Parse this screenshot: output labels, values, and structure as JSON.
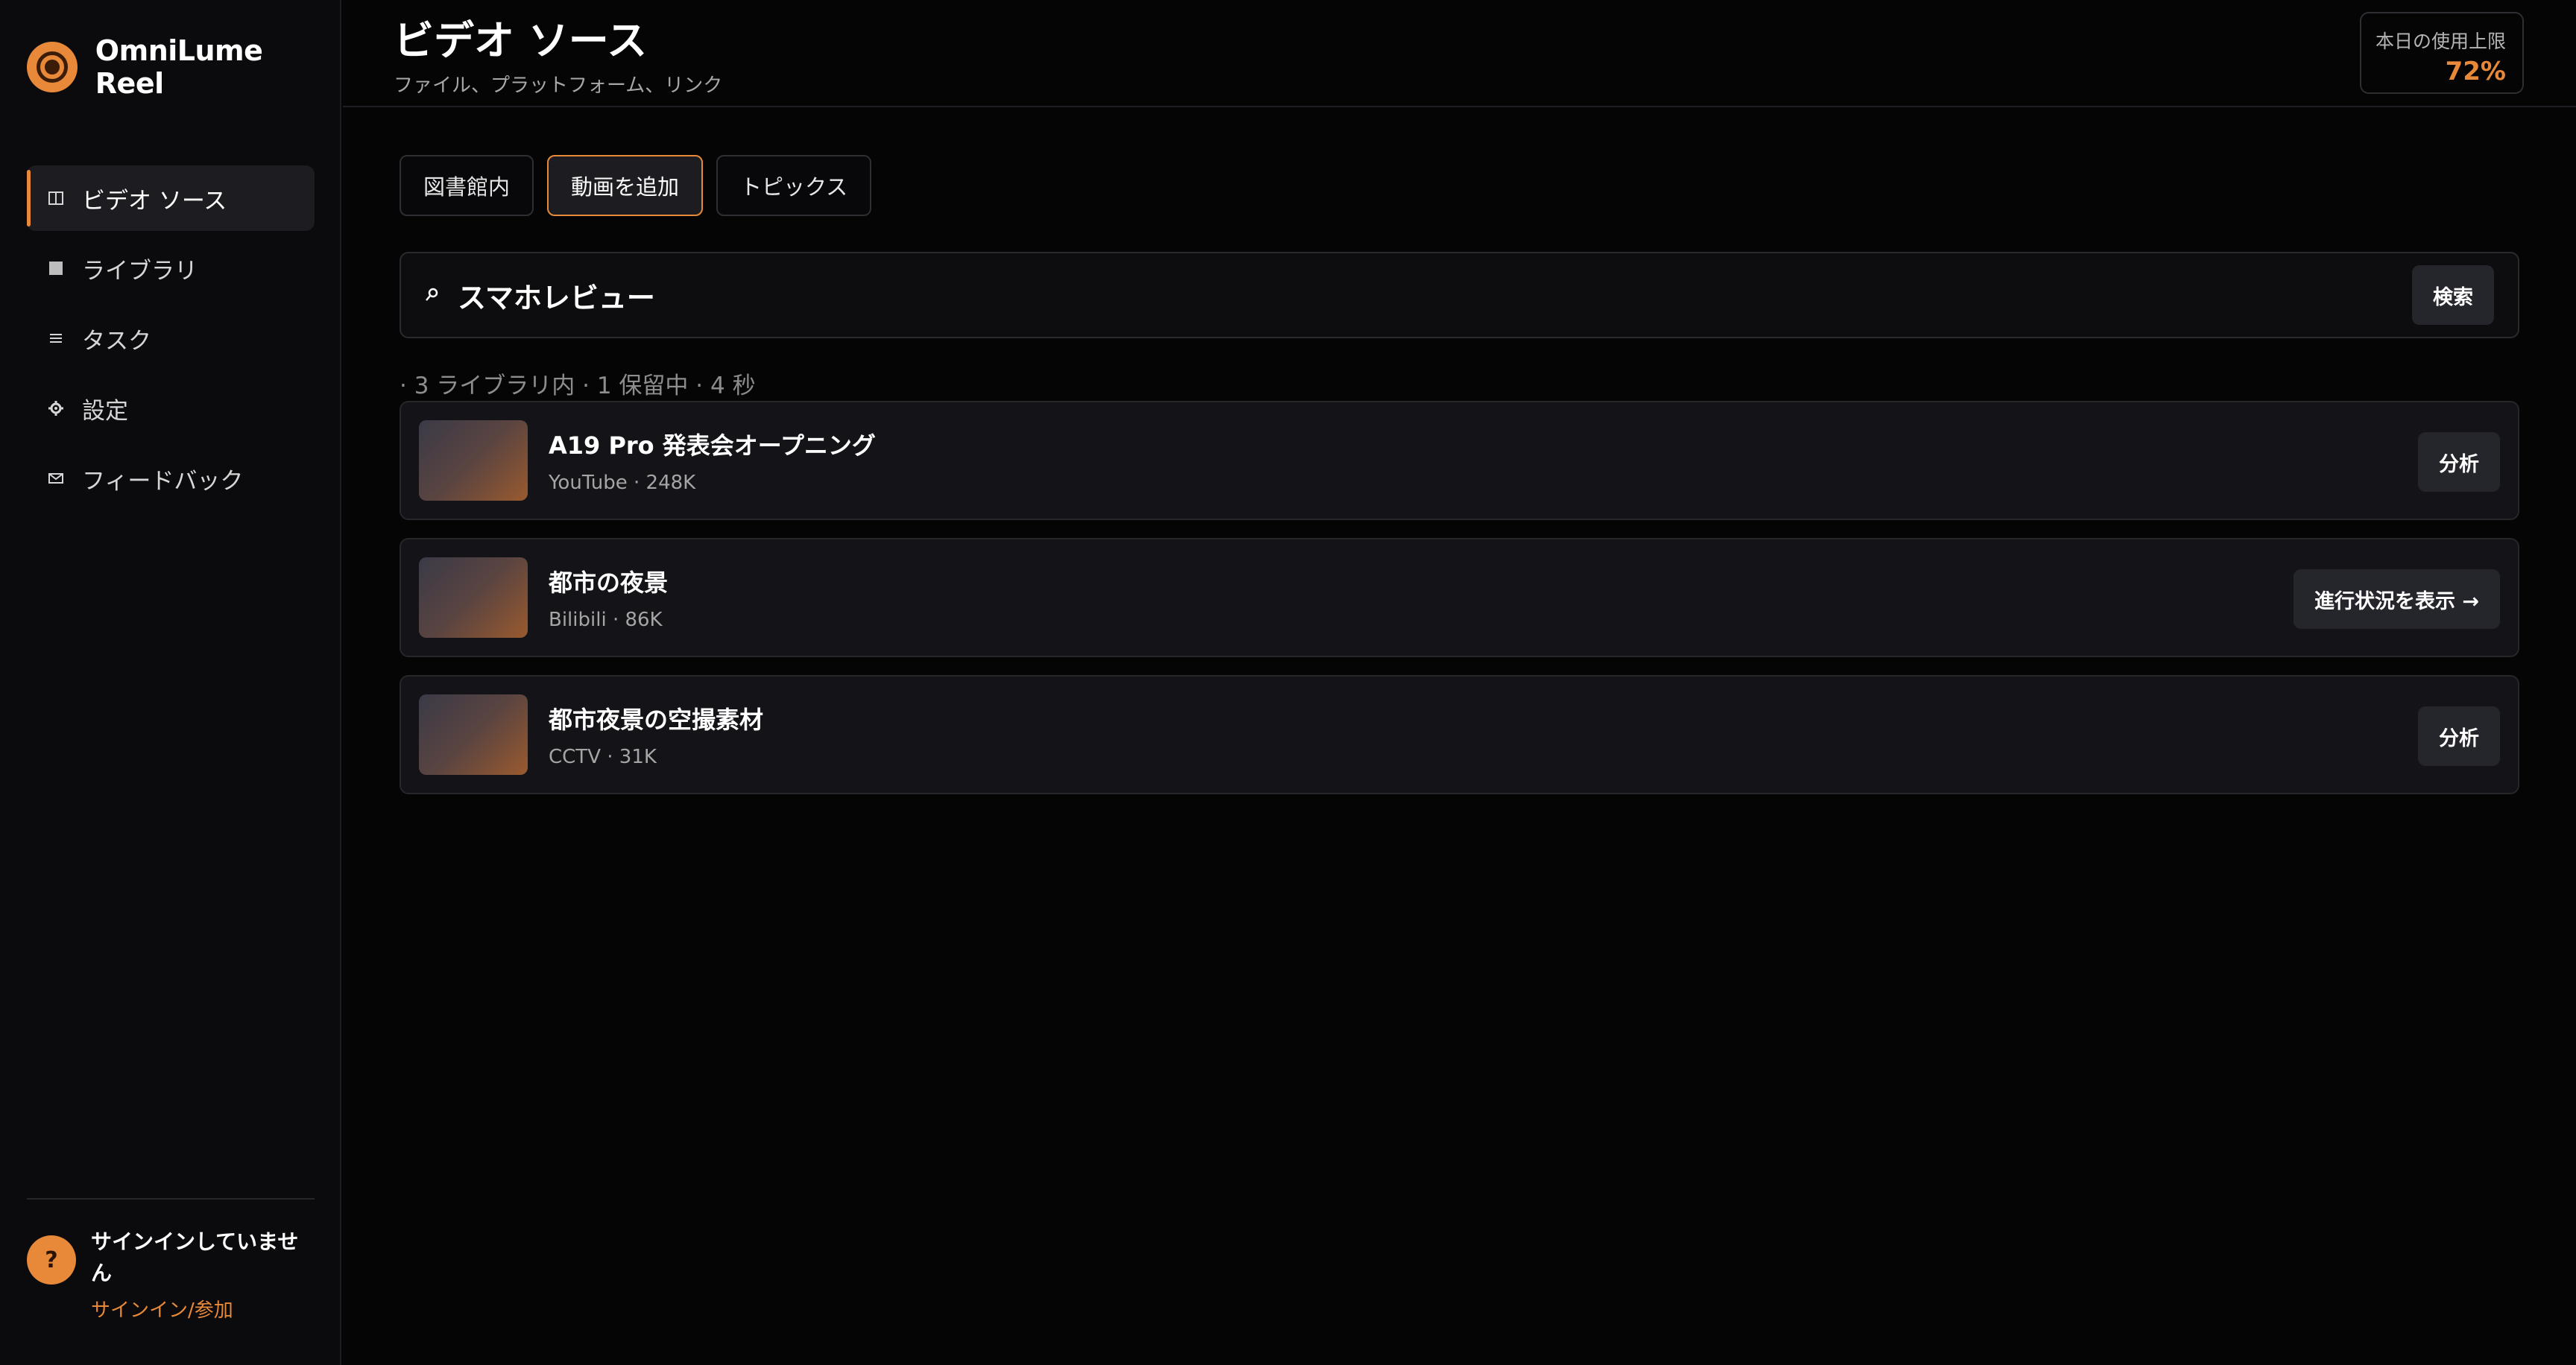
{
  "app": {
    "name": "OmniLume Reel"
  },
  "sidebar": {
    "items": [
      {
        "label": "ビデオ ソース",
        "icon": "columns-icon"
      },
      {
        "label": "ライブラリ",
        "icon": "square-icon"
      },
      {
        "label": "タスク",
        "icon": "list-icon"
      },
      {
        "label": "設定",
        "icon": "gear-icon"
      },
      {
        "label": "フィードバック",
        "icon": "mail-icon"
      }
    ],
    "active_index": 0,
    "footer": {
      "avatar_glyph": "?",
      "title": "サインインしていません",
      "link": "サインイン/参加"
    }
  },
  "header": {
    "title": "ビデオ ソース",
    "subtitle": "ファイル、プラットフォーム、リンク",
    "usage": {
      "label": "本日の使用上限",
      "value": "72%"
    }
  },
  "tabs": [
    {
      "label": "図書館内",
      "active": false
    },
    {
      "label": "動画を追加",
      "active": true
    },
    {
      "label": "トピックス",
      "active": false
    }
  ],
  "search": {
    "icon_glyph": "⌕",
    "value": "スマホレビュー",
    "button_label": "検索"
  },
  "results_summary": "· 3 ライブラリ内 · 1 保留中 · 4 秒",
  "results": [
    {
      "title": "A19 Pro 発表会オープニング",
      "meta": "YouTube · 248K",
      "action": "分析"
    },
    {
      "title": "都市の夜景",
      "meta": "Bilibili · 86K",
      "action": "進行状況を表示 →"
    },
    {
      "title": "都市夜景の空撮素材",
      "meta": "CCTV · 31K",
      "action": "分析"
    }
  ],
  "colors": {
    "accent": "#e8893a",
    "background": "#050505",
    "sidebar": "#0b0b0d",
    "card": "#141418"
  }
}
